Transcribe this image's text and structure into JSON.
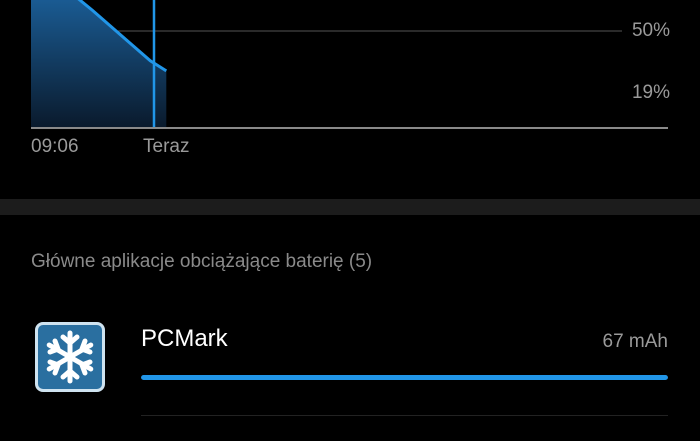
{
  "battery_chart": {
    "y_labels": [
      "50%",
      "19%"
    ],
    "x_labels": [
      "09:06",
      "Teraz"
    ],
    "accent_color": "#2196e8",
    "level_series": [
      {
        "t": 0.0,
        "level": 100
      },
      {
        "t": 0.5,
        "level": 70
      },
      {
        "t": 0.97,
        "level": 40
      },
      {
        "t": 1.1,
        "level": 34
      }
    ]
  },
  "top_apps": {
    "title": "Główne aplikacje obciążające baterię (5)",
    "items": [
      {
        "name": "PCMark",
        "usage": "67 mAh",
        "usage_fraction": 1.0,
        "icon": "snowflake-icon"
      }
    ]
  }
}
